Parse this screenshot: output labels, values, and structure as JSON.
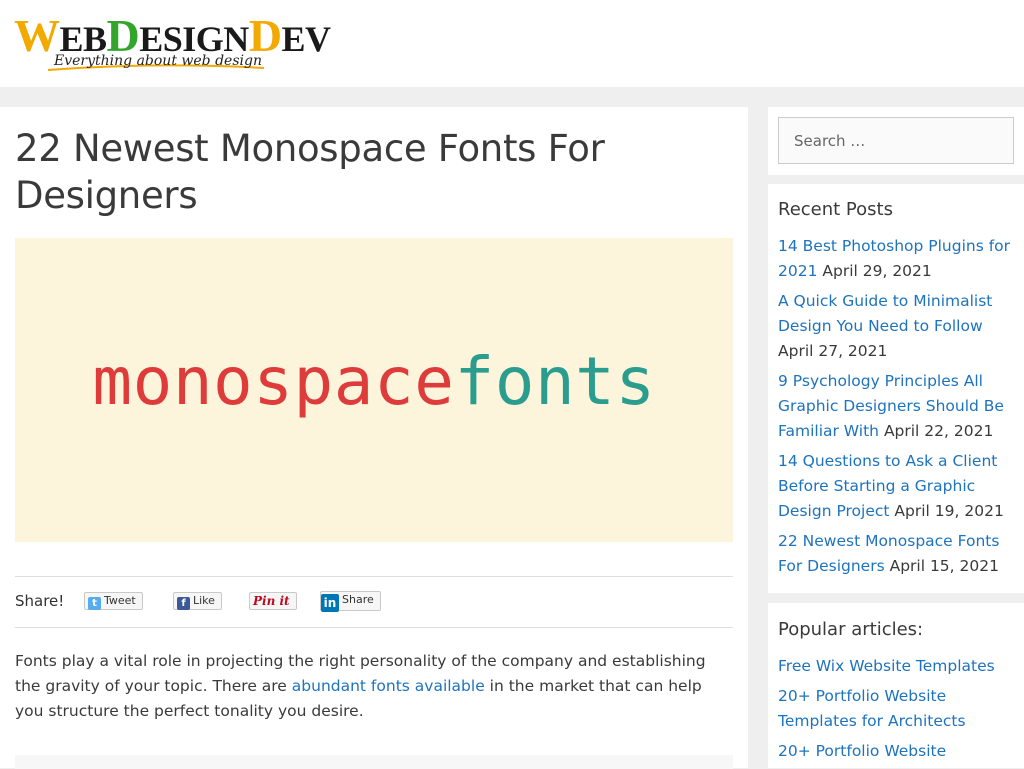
{
  "site": {
    "logo_parts": [
      "W",
      "EB",
      "D",
      "ESIGN",
      "D",
      "EV"
    ],
    "tagline": "Everything about web design"
  },
  "article": {
    "title": "22 Newest Monospace Fonts For Designers",
    "feature_image": {
      "word1": "monospace",
      "word2": "fonts",
      "bg_color": "#fdf4dc",
      "word1_color": "#de3b3b",
      "word2_color": "#2a9d8f"
    },
    "share": {
      "label": "Share!",
      "tweet": "Tweet",
      "like": "Like",
      "pin": "Pin it",
      "linkedin": "Share"
    },
    "body": {
      "before_link": "Fonts play a vital role in projecting the right personality of the company and establishing the gravity of your topic. There are ",
      "link_text": "abundant fonts available",
      "after_link": " in the market that can help you structure the perfect tonality you desire."
    }
  },
  "sidebar": {
    "search_placeholder": "Search …",
    "recent_title": "Recent Posts",
    "recent_posts": [
      {
        "title": "14 Best Photoshop Plugins for 2021",
        "date": "April 29, 2021"
      },
      {
        "title": "A Quick Guide to Minimalist Design You Need to Follow",
        "date": "April 27, 2021"
      },
      {
        "title": "9 Psychology Principles All Graphic Designers Should Be Familiar With",
        "date": "April 22, 2021"
      },
      {
        "title": "14 Questions to Ask a Client Before Starting a Graphic Design Project",
        "date": "April 19, 2021"
      },
      {
        "title": "22 Newest Monospace Fonts For Designers",
        "date": "April 15, 2021"
      }
    ],
    "popular_title": "Popular articles:",
    "popular_posts": [
      "Free Wix Website Templates",
      "20+ Portfolio Website Templates for Architects",
      "20+ Portfolio Website"
    ]
  },
  "colors": {
    "link": "#1e73be",
    "text": "#3a3a3a",
    "page_bg": "#efefef",
    "logo_yellow": "#f2a900",
    "logo_green": "#34a52b"
  }
}
